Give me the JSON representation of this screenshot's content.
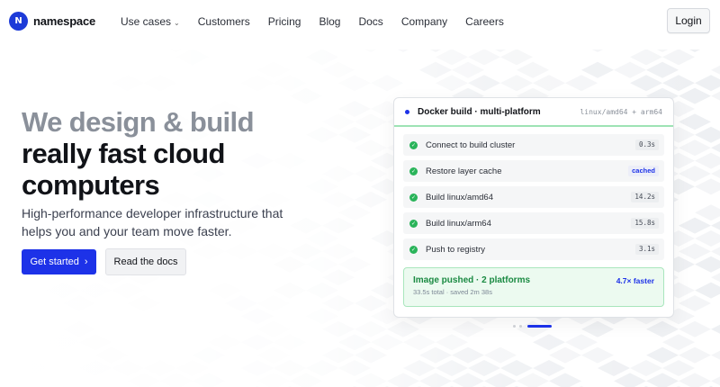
{
  "brand": {
    "logo_mark": "N",
    "name": "namespace",
    "color": "#1d3bd8"
  },
  "nav": {
    "links": [
      {
        "label": "Use cases",
        "has_dropdown": true
      },
      {
        "label": "Customers"
      },
      {
        "label": "Pricing"
      },
      {
        "label": "Blog"
      },
      {
        "label": "Docs"
      },
      {
        "label": "Company"
      },
      {
        "label": "Careers"
      }
    ],
    "login_label": "Login"
  },
  "hero": {
    "title_line1": "We design & build",
    "title_line2": "really fast cloud",
    "title_line3": "computers",
    "subtitle": "High-performance developer infrastructure that helps you and your team move faster.",
    "primary_cta": "Get started",
    "primary_cta_icon": "chevron-right-icon",
    "secondary_cta": "Read the docs"
  },
  "build_card": {
    "title": "Docker build · multi-platform",
    "platforms": "linux/amd64 + arm64",
    "steps": [
      {
        "label": "Connect to build cluster",
        "time": "0.3s",
        "status": "done"
      },
      {
        "label": "Restore layer cache",
        "time": "cached",
        "status": "done"
      },
      {
        "label": "Build linux/amd64",
        "time": "14.2s",
        "status": "done"
      },
      {
        "label": "Build linux/arm64",
        "time": "15.8s",
        "status": "done"
      },
      {
        "label": "Push to registry",
        "time": "3.1s",
        "status": "done"
      }
    ],
    "result": {
      "title": "Image pushed · 2 platforms",
      "detail": "33.5s total · saved 2m 38s",
      "speedup": "4.7× faster"
    }
  },
  "carousel": {
    "slides": 3,
    "active_index": 2
  },
  "colors": {
    "accent": "#1d32e8",
    "success": "#2ab45a",
    "success_bg": "#ecfaf0"
  }
}
